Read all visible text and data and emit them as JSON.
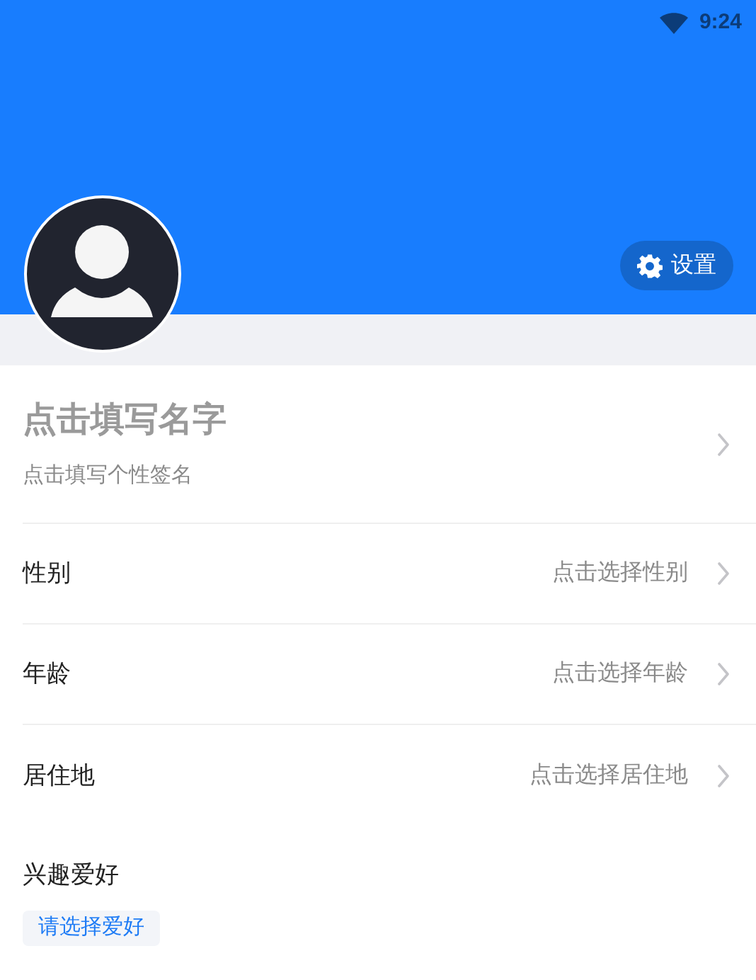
{
  "status_bar": {
    "time": "9:24"
  },
  "header": {
    "settings_button": "设置"
  },
  "profile": {
    "name_placeholder": "点击填写名字",
    "signature_placeholder": "点击填写个性签名"
  },
  "fields": [
    {
      "label": "性别",
      "placeholder": "点击选择性别"
    },
    {
      "label": "年龄",
      "placeholder": "点击选择年龄"
    },
    {
      "label": "居住地",
      "placeholder": "点击选择居住地"
    }
  ],
  "hobbies": {
    "title": "兴趣爱好",
    "button": "请选择爱好"
  }
}
